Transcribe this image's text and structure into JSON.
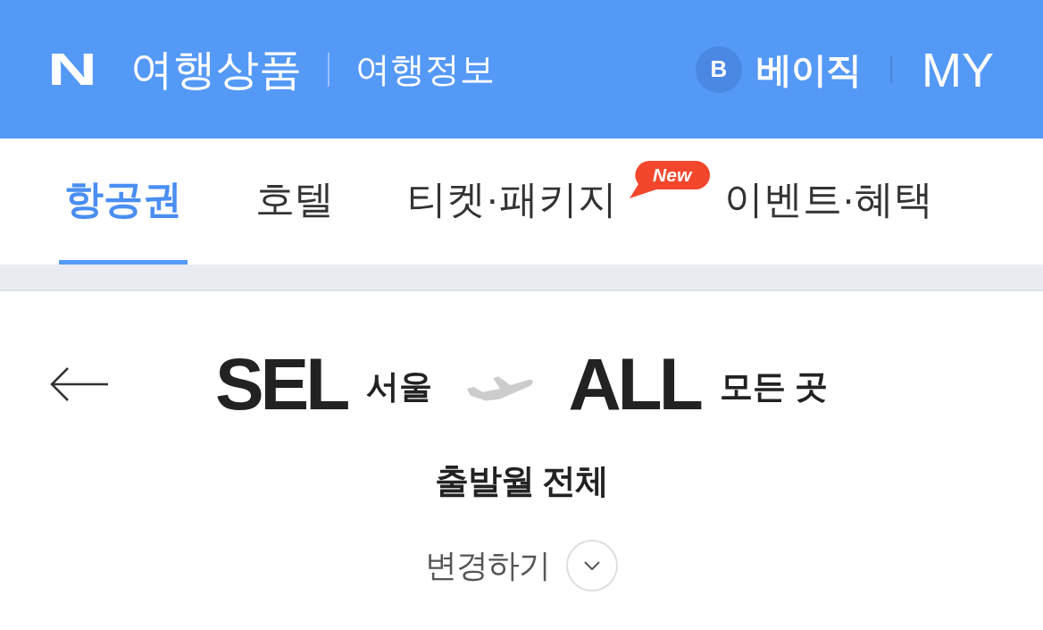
{
  "header": {
    "logo": "N",
    "title": "여행상품",
    "link": "여행정보",
    "membership": {
      "badge": "B",
      "label": "베이직"
    },
    "my": "MY"
  },
  "tabs": [
    {
      "label": "항공권",
      "selected": true
    },
    {
      "label": "호텔",
      "selected": false
    },
    {
      "label": "티켓·패키지",
      "selected": false,
      "badge": "New"
    },
    {
      "label": "이벤트·혜택",
      "selected": false
    }
  ],
  "route": {
    "origin": {
      "code": "SEL",
      "name": "서울"
    },
    "destination": {
      "code": "ALL",
      "name": "모든 곳"
    }
  },
  "departure_month": "출발월 전체",
  "change_button": {
    "label": "변경하기",
    "expanded": false
  }
}
